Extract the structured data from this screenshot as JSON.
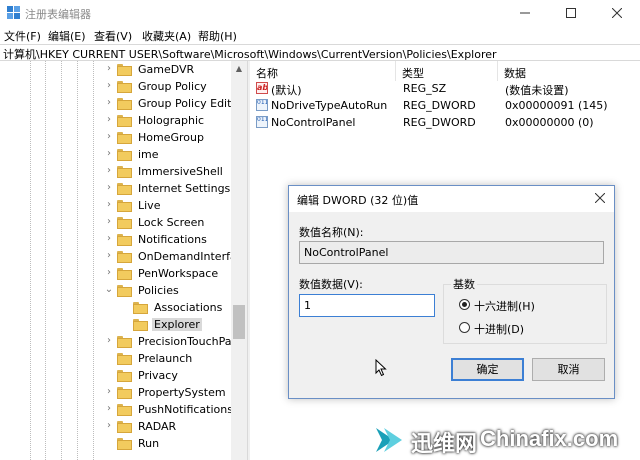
{
  "window": {
    "title": "注册表编辑器",
    "icon": "registry-editor-icon"
  },
  "menu": [
    "文件(F)",
    "编辑(E)",
    "查看(V)",
    "收藏夹(A)",
    "帮助(H)"
  ],
  "address": "计算机\\HKEY CURRENT USER\\Software\\Microsoft\\Windows\\CurrentVersion\\Policies\\Explorer",
  "tree": [
    {
      "label": "GameDVR",
      "expander": "›"
    },
    {
      "label": "Group Policy",
      "expander": "›"
    },
    {
      "label": "Group Policy Editor",
      "expander": "›"
    },
    {
      "label": "Holographic",
      "expander": "›"
    },
    {
      "label": "HomeGroup",
      "expander": "›"
    },
    {
      "label": "ime",
      "expander": "›"
    },
    {
      "label": "ImmersiveShell",
      "expander": "›"
    },
    {
      "label": "Internet Settings",
      "expander": "›"
    },
    {
      "label": "Live",
      "expander": "›"
    },
    {
      "label": "Lock Screen",
      "expander": "›"
    },
    {
      "label": "Notifications",
      "expander": "›"
    },
    {
      "label": "OnDemandInterfac",
      "expander": "›"
    },
    {
      "label": "PenWorkspace",
      "expander": "›"
    },
    {
      "label": "Policies",
      "expander": "⌄"
    },
    {
      "label": "Associations",
      "expander": ""
    },
    {
      "label": "Explorer",
      "expander": "",
      "selected": true
    },
    {
      "label": "PrecisionTouchPad",
      "expander": "›"
    },
    {
      "label": "Prelaunch",
      "expander": ""
    },
    {
      "label": "Privacy",
      "expander": ""
    },
    {
      "label": "PropertySystem",
      "expander": "›"
    },
    {
      "label": "PushNotifications",
      "expander": "›"
    },
    {
      "label": "RADAR",
      "expander": "›"
    },
    {
      "label": "Run",
      "expander": ""
    }
  ],
  "columns": {
    "name": "名称",
    "type": "类型",
    "data": "数据"
  },
  "values": [
    {
      "icon": "ab",
      "name": "(默认)",
      "type": "REG_SZ",
      "data": "(数值未设置)"
    },
    {
      "icon": "011 110",
      "name": "NoDriveTypeAutoRun",
      "type": "REG_DWORD",
      "data": "0x00000091 (145)"
    },
    {
      "icon": "011 110",
      "name": "NoControlPanel",
      "type": "REG_DWORD",
      "data": "0x00000000 (0)"
    }
  ],
  "dialog": {
    "title": "编辑 DWORD (32 位)值",
    "name_label": "数值名称(N):",
    "name_value": "NoControlPanel",
    "data_label": "数值数据(V):",
    "data_value": "1",
    "base_label": "基数",
    "hex_label": "十六进制(H)",
    "dec_label": "十进制(D)",
    "base_selected": "hex",
    "ok_label": "确定",
    "cancel_label": "取消"
  },
  "watermark": {
    "text1": "迅维网",
    "text2": "Chinafix.com"
  }
}
